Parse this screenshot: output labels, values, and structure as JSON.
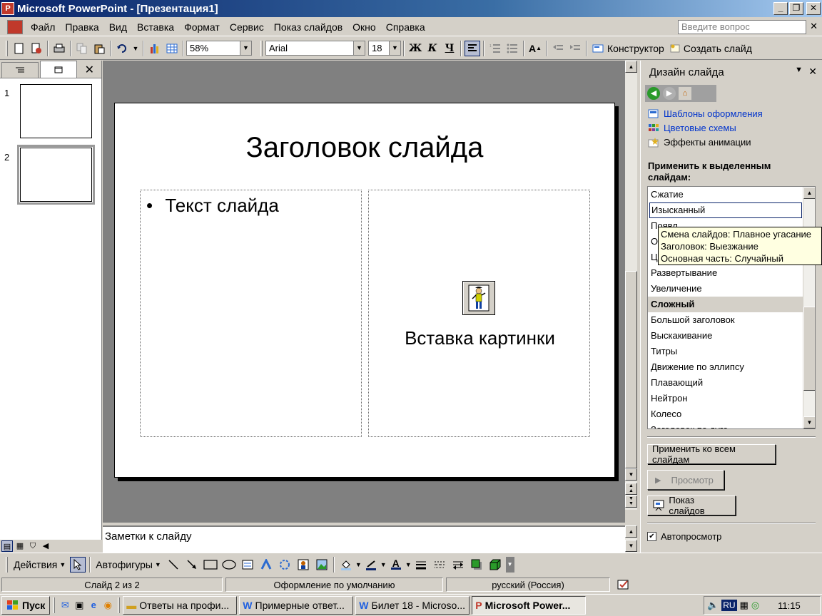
{
  "window": {
    "title": "Microsoft PowerPoint - [Презентация1]",
    "minimize": "_",
    "restore": "❐",
    "close": "✕"
  },
  "menu": {
    "items": [
      "Файл",
      "Правка",
      "Вид",
      "Вставка",
      "Формат",
      "Сервис",
      "Показ слайдов",
      "Окно",
      "Справка"
    ],
    "help_placeholder": "Введите вопрос",
    "close": "✕"
  },
  "toolbar": {
    "zoom": "58%",
    "font": "Arial",
    "font_size": "18",
    "bold": "Ж",
    "italic": "К",
    "underline": "Ч",
    "designer": "Конструктор",
    "new_slide": "Создать слайд"
  },
  "left_pane": {
    "close": "✕",
    "slides": [
      {
        "num": "1"
      },
      {
        "num": "2"
      }
    ]
  },
  "slide": {
    "title": "Заголовок слайда",
    "bullet": "•",
    "body_text": "Текст слайда",
    "clipart_caption": "Вставка картинки"
  },
  "notes": {
    "placeholder": "Заметки к слайду"
  },
  "task_pane": {
    "title": "Дизайн слайда",
    "links": [
      "Шаблоны оформления",
      "Цветовые схемы",
      "Эффекты анимации"
    ],
    "apply_label": "Применить к выделенным слайдам:",
    "list_items": [
      "Сжатие",
      "Изысканный",
      "Появл",
      "От",
      "Це",
      "Развертывание",
      "Увеличение",
      "Сложный",
      "Большой заголовок",
      "Выскакивание",
      "Титры",
      "Движение по эллипсу",
      "Плавающий",
      "Нейтрон",
      "Колесо",
      "Заголовок по дуге"
    ],
    "focused_index": 1,
    "selected_index": 7,
    "tooltip": [
      "Смена слайдов: Плавное угасание",
      "Заголовок: Выезжание",
      "Основная часть: Случайный"
    ],
    "apply_all": "Применить ко всем слайдам",
    "preview": "Просмотр",
    "slideshow": "Показ слайдов",
    "autopreview": "Автопросмотр",
    "autopreview_checked": true
  },
  "drawbar": {
    "actions": "Действия",
    "autoshapes": "Автофигуры"
  },
  "status": {
    "slide": "Слайд 2 из 2",
    "design": "Оформление по умолчанию",
    "language": "русский (Россия)"
  },
  "taskbar": {
    "start": "Пуск",
    "tasks": [
      {
        "label": "Ответы на профи...",
        "active": false
      },
      {
        "label": "Примерные ответ...",
        "active": false
      },
      {
        "label": "Билет 18 - Microso...",
        "active": false
      },
      {
        "label": "Microsoft Power...",
        "active": true
      }
    ],
    "lang": "RU",
    "time": "11:15"
  },
  "colors": {
    "title_bar": "#0a246a",
    "link": "#0033cc",
    "workspace": "#808080",
    "tooltip_bg": "#ffffe1"
  }
}
